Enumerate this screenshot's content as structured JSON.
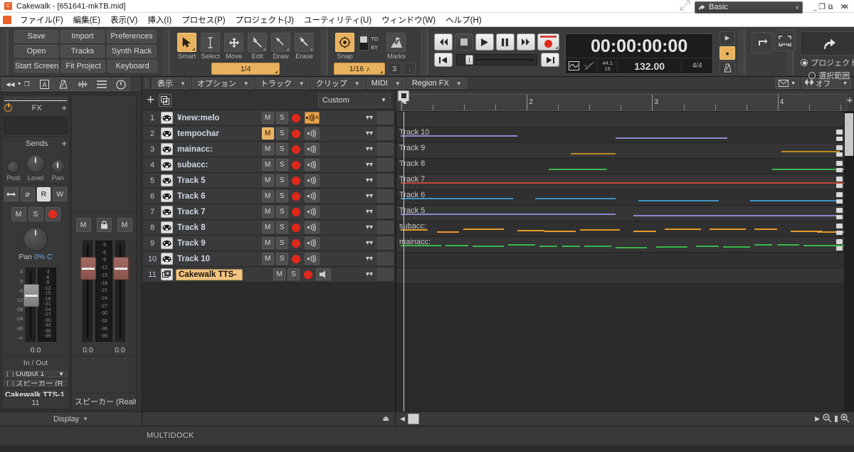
{
  "window": {
    "title": "Cakewalk - [651641-mkTB.mid]",
    "app_icon": "cakewalk-icon",
    "minimize": "–",
    "maximize": "❐",
    "close": "✕"
  },
  "menubar": {
    "items": [
      {
        "label": "ファイル(F)",
        "name": "menu-file"
      },
      {
        "label": "編集(E)",
        "name": "menu-edit"
      },
      {
        "label": "表示(V)",
        "name": "menu-view"
      },
      {
        "label": "挿入(I)",
        "name": "menu-insert"
      },
      {
        "label": "プロセス(P)",
        "name": "menu-process"
      },
      {
        "label": "プロジェクト(J)",
        "name": "menu-project"
      },
      {
        "label": "ユーティリティ(U)",
        "name": "menu-utilities"
      },
      {
        "label": "ウィンドウ(W)",
        "name": "menu-window"
      },
      {
        "label": "ヘルプ(H)",
        "name": "menu-help"
      }
    ]
  },
  "controlbar": {
    "quickbuttons": [
      [
        "Save",
        "Import",
        "Preferences"
      ],
      [
        "Open",
        "Tracks",
        "Synth Rack"
      ],
      [
        "Start Screen",
        "Fit Project",
        "Keyboard"
      ]
    ],
    "tools": [
      {
        "label": "Smart",
        "icon": "arrow-cursor-icon",
        "active": true
      },
      {
        "label": "Select",
        "icon": "i-beam-icon",
        "active": false
      },
      {
        "label": "Move",
        "icon": "move-cross-icon",
        "active": false
      },
      {
        "label": "Edit",
        "icon": "wrench-icon",
        "active": false
      },
      {
        "label": "Draw",
        "icon": "pencil-icon",
        "active": false
      },
      {
        "label": "Erase",
        "icon": "eraser-icon",
        "active": false
      }
    ],
    "tool_resolution": "1/4",
    "snap": {
      "label": "Snap",
      "icon": "snap-target-icon",
      "to_label": "TO",
      "by_label": "BY",
      "value": "1/16",
      "note_glyph": "♪",
      "count": "3",
      "dot": "."
    },
    "marks": {
      "label": "Marks",
      "icon": "marker-flag-icon"
    },
    "transport": {
      "rewind": "◀◀",
      "stop": "■",
      "play": "▶",
      "pause": "❚❚",
      "forward": "▶▶",
      "record": "record-button",
      "go_start": "◀❘",
      "go_end": "❘▶"
    },
    "time": {
      "display": "00:00:00:00",
      "sample_rate_top": "44.1",
      "sample_rate_bottom": "16",
      "tempo": "132.00",
      "time_signature": "4/4",
      "wave_icon": "waveform-icon",
      "nodraw_icon": "no-draw-icon"
    },
    "micro": {
      "play_icon": "▶",
      "dot_icon": "●",
      "metronome_icon": "metronome-icon"
    },
    "loop_icon": "loop-icon",
    "fit_icon": "fit-selection-icon",
    "export": {
      "icon": "export-share-icon",
      "options": [
        {
          "label": "プロジェクト",
          "selected": true
        },
        {
          "label": "選択範囲",
          "selected": false
        }
      ]
    },
    "workspace": {
      "label": "Basic",
      "icon": "workspace-icon",
      "chevron": "∨"
    },
    "expand_icon": "expand-arrows-icon"
  },
  "inspector": {
    "toolbar": [
      {
        "name": "rewind-nav-icon",
        "glyph": "◀◀"
      },
      {
        "name": "filter-chevron-icon",
        "glyph": "▼"
      },
      {
        "name": "duplicate-icon",
        "glyph": "❐"
      },
      {
        "name": "text-box-icon",
        "glyph": "A"
      },
      {
        "name": "metronome-icon",
        "glyph": "⚗"
      },
      {
        "name": "waveform-icon",
        "glyph": "⁘"
      },
      {
        "name": "hamburger-menu-icon",
        "glyph": "☰"
      },
      {
        "name": "power-icon",
        "glyph": "⏻"
      }
    ],
    "fx": {
      "label": "FX",
      "add": "+",
      "power": "power-icon"
    },
    "sends": {
      "label": "Sends",
      "add": "+"
    },
    "send_knobs": [
      {
        "label": "Post",
        "type": "dot"
      },
      {
        "label": "Level",
        "type": "knob"
      },
      {
        "label": "Pan",
        "type": "knob"
      }
    ],
    "strip_buttons": [
      {
        "name": "interleave-icon",
        "glyph": "▶◀",
        "lit": false
      },
      {
        "name": "phase-invert-icon",
        "glyph": "⌀",
        "lit": false
      },
      {
        "name": "automation-read-button",
        "glyph": "R",
        "lit": true
      },
      {
        "name": "automation-write-button",
        "glyph": "W",
        "lit": false
      }
    ],
    "mute_solo": [
      {
        "name": "mute-button",
        "glyph": "M"
      },
      {
        "name": "solo-button",
        "glyph": "S"
      },
      {
        "name": "arm-record-button",
        "glyph": ""
      }
    ],
    "pan": {
      "label": "Pan",
      "value": "0% C"
    },
    "fader_scale": [
      "6",
      "0",
      "-6",
      "-12",
      "-18",
      "-24",
      "-36",
      "-∞"
    ],
    "meter_scale": [
      "-3",
      "-6",
      "-9",
      "-12",
      "-15",
      "-18",
      "-21",
      "-24",
      "-27",
      "-30",
      "-33",
      "-36",
      "-39"
    ],
    "gain_values": [
      "0.0",
      "0.0",
      "0.0"
    ],
    "io": {
      "label": "In / Out",
      "input": "Output 1",
      "output": "スピーカー (R",
      "input_icon": "input-port-icon",
      "output_icon": "output-port-icon"
    },
    "strip_name": "Cakewalk TTS-1",
    "strip_number": "11",
    "aux_strip_name": "スピーカー (Realte",
    "aux_buttons": [
      {
        "name": "mute-button",
        "glyph": "M"
      },
      {
        "name": "lock-button",
        "glyph": "🔒"
      },
      {
        "name": "mute-button-2",
        "glyph": "M"
      }
    ],
    "display_bar": {
      "label": "Display",
      "chevron": "▼"
    }
  },
  "trackview": {
    "menus": [
      {
        "label": "表示",
        "name": "tv-menu-view"
      },
      {
        "label": "オプション",
        "name": "tv-menu-options"
      },
      {
        "label": "トラック",
        "name": "tv-menu-track"
      },
      {
        "label": "クリップ",
        "name": "tv-menu-clip"
      },
      {
        "label": "MIDI",
        "name": "tv-menu-midi"
      },
      {
        "label": "Region FX",
        "name": "tv-menu-regionfx"
      }
    ],
    "right_controls": {
      "envelope_icon": "envelope-icon",
      "move_icon": "move-horizontal-icon",
      "automation_mode": "オフ"
    },
    "toolbar": {
      "add_track": "+",
      "add_track_icon": "add-track-icon",
      "duplicate_icon": "insert-multiple-icon",
      "preset": "Custom",
      "preset_chevron": "▼"
    },
    "columns": {
      "mute": "M",
      "solo": "S",
      "record": "record-arm",
      "echo": "input-echo"
    },
    "tracks": [
      {
        "num": "1",
        "name": "¥new:melody",
        "icon": "midi-track-icon",
        "mute_lit": false,
        "echo_lit": true
      },
      {
        "num": "2",
        "name": "tempochange:",
        "icon": "midi-track-icon",
        "mute_lit": true,
        "echo_lit": false
      },
      {
        "num": "3",
        "name": "mainacc:",
        "icon": "midi-track-icon",
        "mute_lit": false,
        "echo_lit": false
      },
      {
        "num": "4",
        "name": "subacc:",
        "icon": "midi-track-icon",
        "mute_lit": false,
        "echo_lit": false
      },
      {
        "num": "5",
        "name": "Track 5",
        "icon": "midi-track-icon",
        "mute_lit": false,
        "echo_lit": false
      },
      {
        "num": "6",
        "name": "Track 6",
        "icon": "midi-track-icon",
        "mute_lit": false,
        "echo_lit": false
      },
      {
        "num": "7",
        "name": "Track 7",
        "icon": "midi-track-icon",
        "mute_lit": false,
        "echo_lit": false
      },
      {
        "num": "8",
        "name": "Track 8",
        "icon": "midi-track-icon",
        "mute_lit": false,
        "echo_lit": false
      },
      {
        "num": "9",
        "name": "Track 9",
        "icon": "midi-track-icon",
        "mute_lit": false,
        "echo_lit": false
      },
      {
        "num": "10",
        "name": "Track 10",
        "icon": "midi-track-icon",
        "mute_lit": false,
        "echo_lit": false
      },
      {
        "num": "11",
        "name": "Cakewalk TTS-",
        "icon": "synth-track-icon",
        "mute_lit": false,
        "echo_lit": false,
        "editing": true,
        "echo_glyph": "➤"
      }
    ],
    "eject_icon": "⏏"
  },
  "timeline": {
    "measures": [
      "1",
      "2",
      "3",
      "4"
    ],
    "now_time": "1",
    "plus": "+"
  },
  "clips": {
    "lanes": [
      {
        "label": "",
        "color": "#3a3a3a",
        "notes": []
      },
      {
        "label": "",
        "color": "#3a3a3a",
        "notes": []
      },
      {
        "label": "mainacc:",
        "color": "#3ab54a",
        "notes": [
          [
            1,
            9
          ],
          [
            11,
            5
          ],
          [
            17,
            7
          ],
          [
            25,
            6
          ],
          [
            32,
            4
          ],
          [
            37,
            4
          ],
          [
            42,
            6
          ],
          [
            49,
            7
          ],
          [
            58,
            7
          ],
          [
            67,
            5
          ],
          [
            73,
            6
          ],
          [
            80,
            4
          ],
          [
            85,
            5
          ],
          [
            91,
            5
          ],
          [
            96,
            4
          ]
        ]
      },
      {
        "label": "subacc:",
        "color": "#e8992a",
        "notes": [
          [
            1,
            6
          ],
          [
            9,
            5
          ],
          [
            15,
            9
          ],
          [
            27,
            6
          ],
          [
            33,
            7
          ],
          [
            41,
            9
          ],
          [
            53,
            5
          ],
          [
            60,
            8
          ],
          [
            70,
            8
          ],
          [
            80,
            5
          ],
          [
            88,
            7
          ],
          [
            94,
            6
          ]
        ]
      },
      {
        "label": "Track 5",
        "color": "#8b8ad0",
        "notes": [
          [
            1,
            48
          ],
          [
            53,
            46
          ]
        ]
      },
      {
        "label": "Track 6",
        "color": "#3d95c4",
        "notes": [
          [
            1,
            25
          ],
          [
            31,
            18
          ],
          [
            54,
            18
          ],
          [
            79,
            20
          ]
        ]
      },
      {
        "label": "Track 7",
        "color": "#c4463a",
        "notes": [
          [
            1,
            99
          ]
        ]
      },
      {
        "label": "Track 8",
        "color": "#3ab54a",
        "notes": [
          [
            34,
            13
          ],
          [
            84,
            16
          ]
        ]
      },
      {
        "label": "Track 9",
        "color": "#c08a1e",
        "notes": [
          [
            39,
            10
          ],
          [
            86,
            13
          ]
        ]
      },
      {
        "label": "Track 10",
        "color": "#8b8ad0",
        "notes": [
          [
            1,
            26
          ],
          [
            49,
            25
          ]
        ]
      },
      {
        "label": "",
        "color": "#3a3a3a",
        "notes": []
      }
    ],
    "scroll_up_icon": "scroll-up-icon",
    "zoom_out_icon": "zoom-out-icon",
    "zoom_in_icon": "zoom-in-icon",
    "left_arrow": "◀",
    "right_arrow": "▶"
  },
  "multidock": {
    "label": "MULTIDOCK"
  },
  "colors": {
    "accent": "#e8b25e",
    "record": "#e0281a",
    "panel": "#3a3a3a",
    "background": "#2b2b2b"
  }
}
